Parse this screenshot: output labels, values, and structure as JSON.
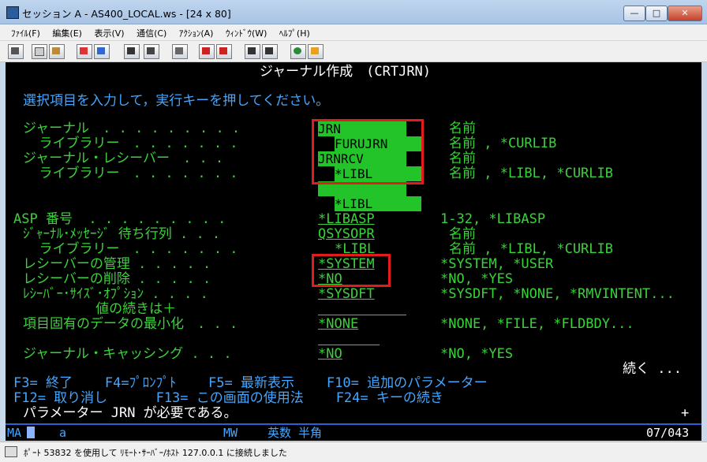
{
  "window": {
    "title": "セッション A - AS400_LOCAL.ws - [24 x 80]"
  },
  "menu": [
    "ﾌｧｲﾙ(F)",
    "編集(E)",
    "表示(V)",
    "通信(C)",
    "ｱｸｼｮﾝ(A)",
    "ｳｨﾝﾄﾞｳ(W)",
    "ﾍﾙﾌﾟ(H)"
  ],
  "toolbar_icons": [
    "print-screen-icon",
    "copy-icon",
    "paste-icon",
    "send-icon",
    "receive-icon",
    "display-icon",
    "keypad-icon",
    "macro-icon",
    "record-icon",
    "stop-icon",
    "play-icon",
    "run-icon",
    "globe-icon",
    "edit-icon"
  ],
  "screen": {
    "title": "ジャーナル作成　(CRTJRN)",
    "instruction": "選択項目を入力して，実行キーを押してください。",
    "rows": [
      {
        "label": "ジャーナル　. . . . . . . . .",
        "value": "JRN",
        "hint": "名前"
      },
      {
        "label": "  ライブラリー　. . . . . . .",
        "value": "FURUJRN",
        "hint": "名前 , *CURLIB"
      },
      {
        "label": "ジャーナル・レシーバー　. . .",
        "value": "JRNRCV",
        "hint": "名前"
      },
      {
        "label": "  ライブラリー　. . . . . . .",
        "value": "*LIBL",
        "hint": "名前 , *LIBL, *CURLIB"
      },
      {
        "label": "",
        "value": "",
        "hint": ""
      },
      {
        "label": "",
        "value": "*LIBL",
        "hint": ""
      },
      {
        "label": "ASP 番号  . . . . . . . . .",
        "value": "*LIBASP",
        "hint": "1-32, *LIBASP"
      },
      {
        "label": "ｼﾞｬｰﾅﾙ･ﾒｯｾｰｼﾞ 待ち行列 . . .",
        "value": "QSYSOPR",
        "hint": "名前"
      },
      {
        "label": "  ライブラリー　. . . . . . .",
        "value": "*LIBL",
        "hint": "名前 , *LIBL, *CURLIB"
      },
      {
        "label": "レシーバーの管理 . . . . .",
        "value": "*SYSTEM",
        "hint": "*SYSTEM, *USER"
      },
      {
        "label": "レシーバーの削除 . . . . .",
        "value": "*NO",
        "hint": "*NO, *YES"
      },
      {
        "label": "ﾚｼｰﾊﾞｰ･ｻｲｽﾞ･ｵﾌﾟｼｮﾝ . . . .",
        "value": "*SYSDFT",
        "hint": "*SYSDFT, *NONE, *RMVINTENT..."
      },
      {
        "label": "         値の続きは＋",
        "value": "",
        "hint": ""
      },
      {
        "label": "項目固有のデータの最小化　. . .",
        "value": "*NONE",
        "hint": "*NONE, *FILE, *FLDBDY..."
      },
      {
        "label": "",
        "value": "",
        "hint": ""
      },
      {
        "label": "ジャーナル・キャッシング . . .",
        "value": "*NO",
        "hint": "*NO, *YES"
      }
    ],
    "more": "続く ...",
    "fkeys_row1": "F3= 終了    F4=ﾌﾟﾛﾝﾌﾟﾄ    F5= 最新表示    F10= 追加のパラメーター",
    "fkeys_row2": "F12= 取り消し      F13= この画面の使用法    F24= キーの続き",
    "message": "パラメーター JRN が必要である。",
    "plus": "+"
  },
  "oia": {
    "left": "MA",
    "mode": "a",
    "mw": "MW",
    "ime": "英数 半角",
    "position": "07/043"
  },
  "statusbar": {
    "message": "ﾎﾟｰﾄ 53832 を使用して ﾘﾓｰﾄ･ｻｰﾊﾞｰ/ﾎｽﾄ 127.0.0.1 に接続しました"
  }
}
